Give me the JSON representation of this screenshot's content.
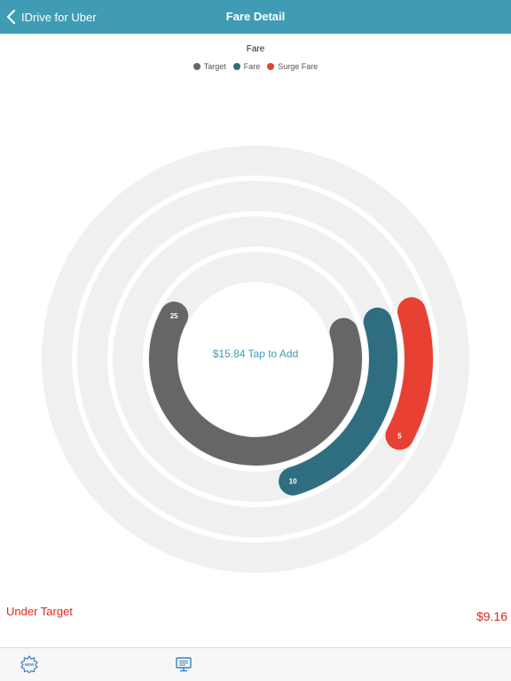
{
  "navbar": {
    "back_label": "IDrive for Uber",
    "title": "Fare Detail",
    "color": "#3f9cb4"
  },
  "chart_data": {
    "type": "radial-bar",
    "title": "Fare",
    "legend": [
      {
        "name": "Target",
        "color": "#666666"
      },
      {
        "name": "Fare",
        "color": "#2e6e80"
      },
      {
        "name": "Surge Fare",
        "color": "#e84134"
      }
    ],
    "series": [
      {
        "name": "Target",
        "value": 25,
        "color": "#666666"
      },
      {
        "name": "Fare",
        "value": 10,
        "color": "#2e6e80"
      },
      {
        "name": "Surge Fare",
        "value": 5,
        "color": "#e84134"
      }
    ],
    "center_text": "$15.84 Tap to Add",
    "center_color": "#3f9cb4",
    "track_color": "#f0f0f0"
  },
  "status": {
    "left": "Under Target",
    "right": "$9.16",
    "color": "#e0261c"
  },
  "tabbar": {
    "icons": [
      "new-badge-icon",
      "monitor-icon"
    ]
  }
}
